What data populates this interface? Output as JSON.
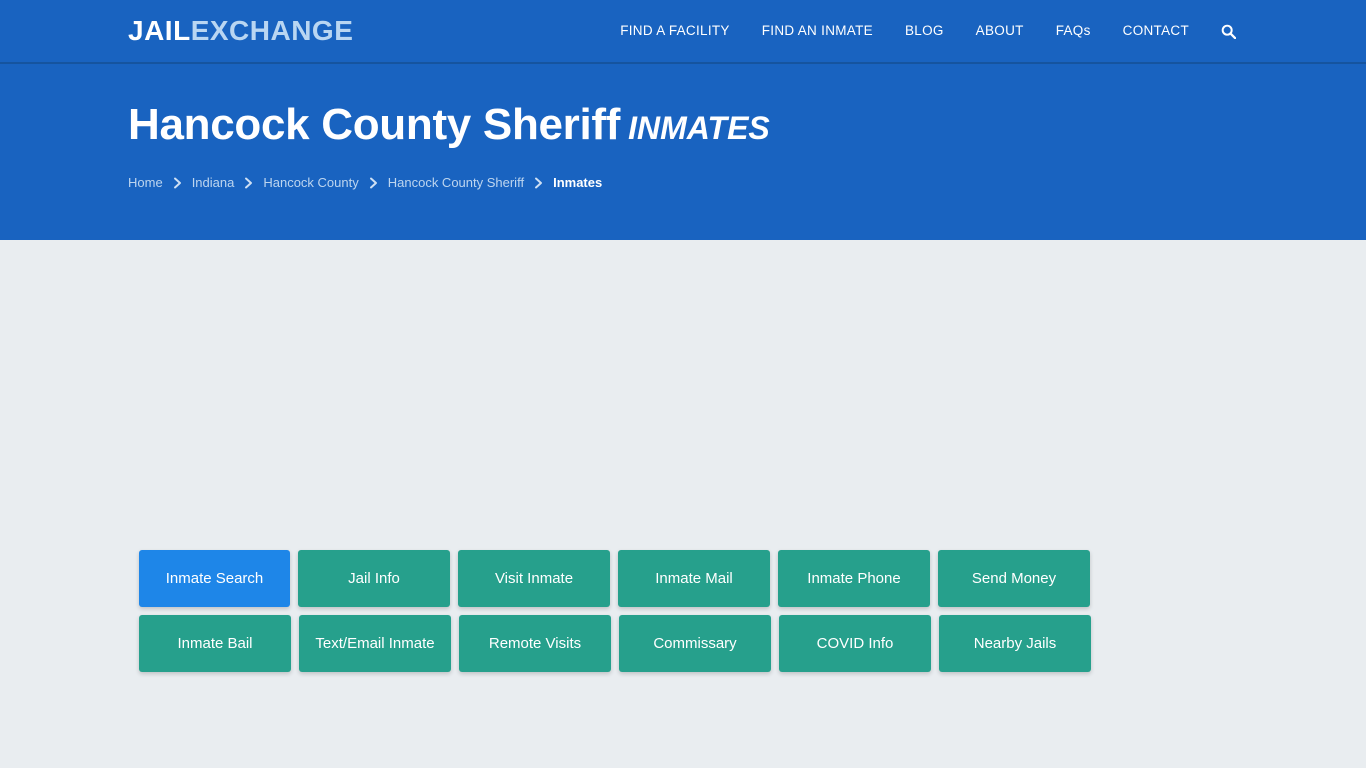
{
  "brand": {
    "logo_part1": "JAIL",
    "logo_part2": "EXCHANGE",
    "color_primary": "#1963c0",
    "color_accent_teal": "#26a08c",
    "color_accent_blue": "#1e86e8",
    "color_page_bg": "#e9edf0"
  },
  "nav": {
    "items": [
      {
        "label": "FIND A FACILITY"
      },
      {
        "label": "FIND AN INMATE"
      },
      {
        "label": "BLOG"
      },
      {
        "label": "ABOUT"
      },
      {
        "label": "FAQs"
      },
      {
        "label": "CONTACT"
      }
    ],
    "search_icon": "search-icon"
  },
  "hero": {
    "title": "Hancock County Sheriff",
    "subtitle": "INMATES",
    "breadcrumb": [
      {
        "label": "Home",
        "current": false
      },
      {
        "label": "Indiana",
        "current": false
      },
      {
        "label": "Hancock County",
        "current": false
      },
      {
        "label": "Hancock County Sheriff",
        "current": false
      },
      {
        "label": "Inmates",
        "current": true
      }
    ],
    "breadcrumb_separator_icon": "chevron-right-icon"
  },
  "tabs": {
    "row1": [
      {
        "label": "Inmate Search",
        "active": true
      },
      {
        "label": "Jail Info",
        "active": false
      },
      {
        "label": "Visit Inmate",
        "active": false
      },
      {
        "label": "Inmate Mail",
        "active": false
      },
      {
        "label": "Inmate Phone",
        "active": false
      },
      {
        "label": "Send Money",
        "active": false
      },
      {
        "label": "Inmate Bail",
        "active": false
      }
    ],
    "row2": [
      {
        "label": "Text/Email Inmate",
        "active": false
      },
      {
        "label": "Remote Visits",
        "active": false
      },
      {
        "label": "Commissary",
        "active": false
      },
      {
        "label": "COVID Info",
        "active": false
      },
      {
        "label": "Nearby Jails",
        "active": false
      }
    ]
  }
}
